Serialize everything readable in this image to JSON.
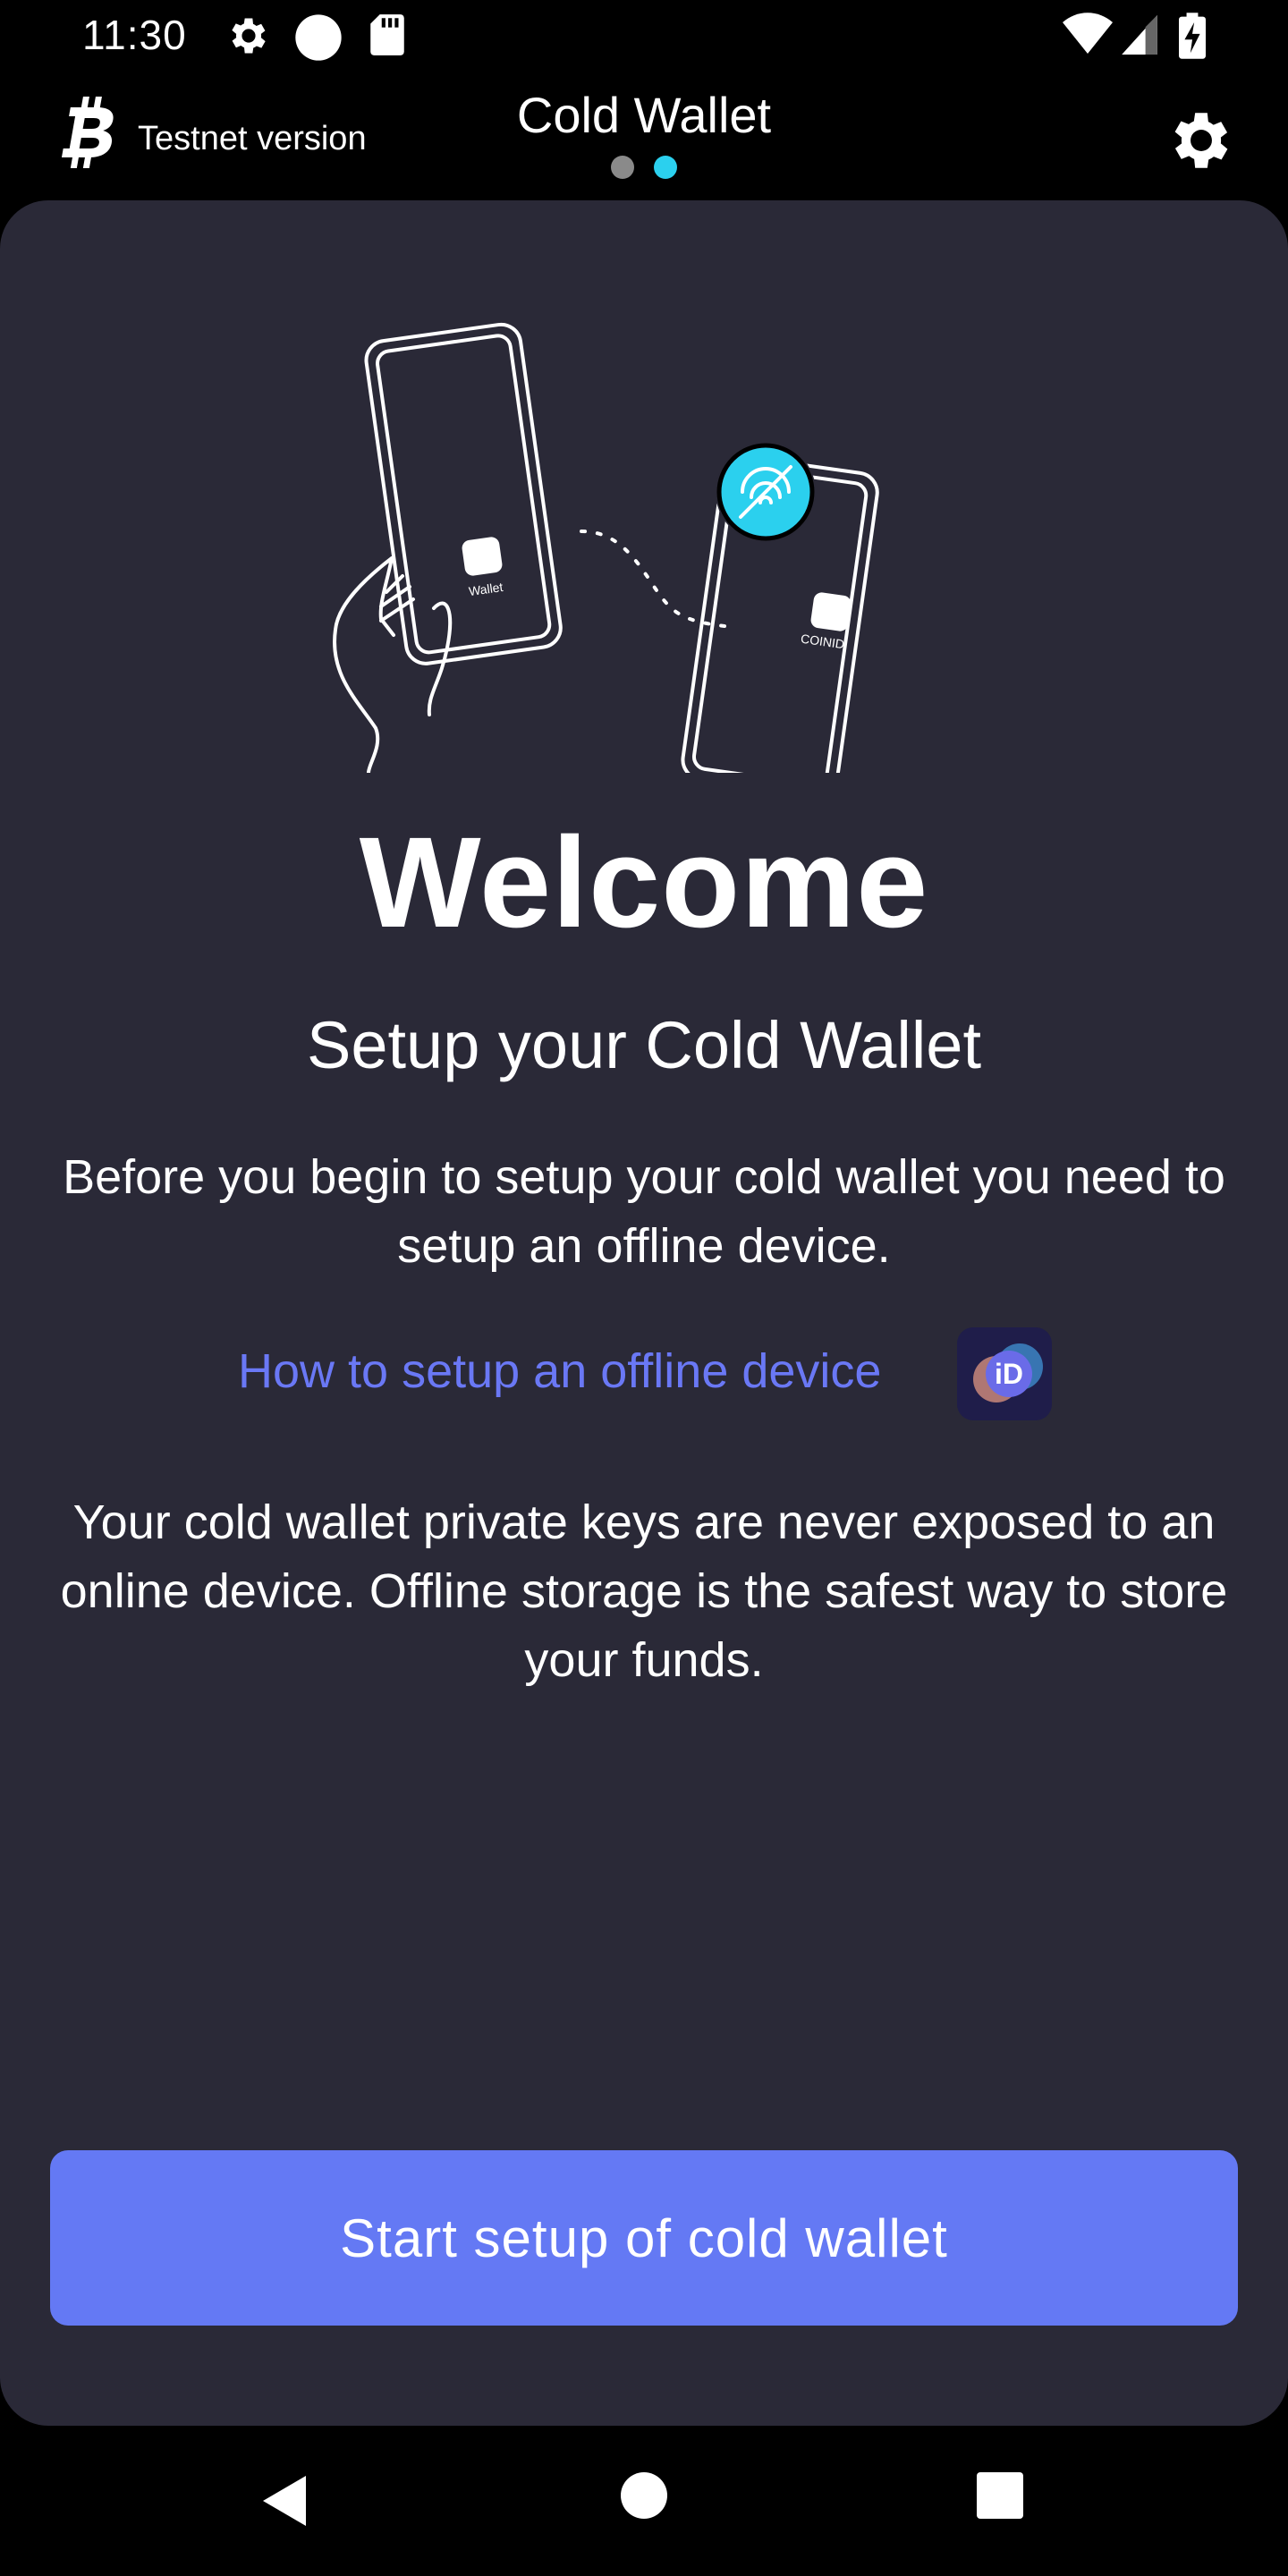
{
  "status_bar": {
    "time": "11:30",
    "icons": [
      "gear-icon",
      "circle-icon",
      "sd-card-icon",
      "wifi-icon",
      "signal-icon",
      "battery-charging-icon"
    ]
  },
  "header": {
    "logo_icon": "bitcoin-icon",
    "network_label": "Testnet version",
    "title": "Cold Wallet",
    "page_indicator": {
      "count": 2,
      "active_index": 1
    },
    "settings_icon": "gear-icon"
  },
  "illustration": {
    "left_phone_label": "Wallet",
    "right_phone_label": "COINID",
    "offline_icon": "no-signal-icon"
  },
  "content": {
    "heading": "Welcome",
    "subtitle": "Setup your Cold Wallet",
    "intro": "Before you begin to setup your cold wallet you need to setup an offline device.",
    "help_link": "How to setup an offline device",
    "help_badge_text": "iD",
    "security_note": "Your cold wallet private keys are never exposed to an online device. Offline storage is the safest way to store your funds."
  },
  "primary_button": {
    "label": "Start setup of cold wallet"
  },
  "nav_bar": {
    "icons": [
      "back-icon",
      "home-icon",
      "recents-icon"
    ]
  },
  "colors": {
    "background": "#000000",
    "card": "#2a2937",
    "accent": "#6479f4",
    "link": "#6a78f5",
    "active_dot": "#2bd0ee"
  }
}
